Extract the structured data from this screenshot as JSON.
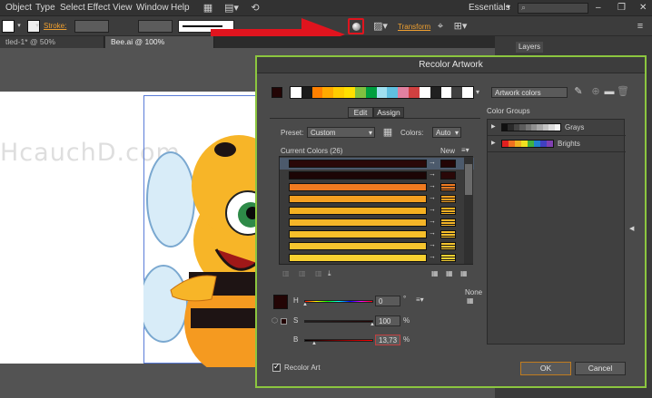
{
  "menu": {
    "items": [
      "Object",
      "Type",
      "Select",
      "Effect",
      "View",
      "Window",
      "Help"
    ],
    "workspace": "Essentials",
    "search_placeholder": ""
  },
  "control_bar": {
    "stroke_label": "Stroke:",
    "transform_label": "Transform"
  },
  "doc_tabs": [
    {
      "label": "tled-1* @ 50% (CMYK/Preview)",
      "active": false
    },
    {
      "label": "Bee.ai @ 100% (CMYK/Preview)",
      "active": true
    }
  ],
  "watermark": "HcauchD.com",
  "panels": {
    "layers_tab": "Layers"
  },
  "dialog": {
    "title": "Recolor Artwork",
    "artwork_colors_label": "Artwork colors",
    "tab_edit": "Edit",
    "tab_assign": "Assign",
    "preset_label": "Preset:",
    "preset_value": "Custom",
    "colors_label": "Colors:",
    "colors_value": "Auto",
    "current_colors_label": "Current Colors (26)",
    "new_label": "New",
    "none_label": "None",
    "h_label": "H",
    "s_label": "S",
    "b_label": "B",
    "h_value": "0",
    "s_value": "100",
    "b_value": "13,73",
    "h_unit": "°",
    "s_unit": "%",
    "b_unit": "%",
    "recolor_art_label": "Recolor Art",
    "recolor_art_checked": true,
    "ok_label": "OK",
    "cancel_label": "Cancel",
    "color_groups_label": "Color Groups",
    "groups": [
      {
        "name": "Grays",
        "colors": [
          "#101010",
          "#2a2a2a",
          "#444444",
          "#5c5c5c",
          "#767676",
          "#8f8f8f",
          "#a8a8a8",
          "#c2c2c2",
          "#dcdcdc",
          "#f5f5f5"
        ]
      },
      {
        "name": "Brights",
        "colors": [
          "#e02020",
          "#f07020",
          "#f0b020",
          "#f0e020",
          "#40b040",
          "#2080d0",
          "#4040c0",
          "#8040b0"
        ]
      }
    ],
    "harmony_strip": [
      "#ffffff",
      "#1a1a1a",
      "#ff8000",
      "#ffaa00",
      "#ffcc00",
      "#ffe000",
      "#80c040",
      "#00a040",
      "#a0e0f0",
      "#60c0e0",
      "#e080a0",
      "#d04040",
      "#ffffff",
      "#202020",
      "#ffffff",
      "#404040",
      "#ffffff"
    ],
    "current_colors": [
      {
        "current": "#2a0808",
        "new": "#230505"
      },
      {
        "current": "#1c0505",
        "new": "#2a0808"
      },
      {
        "current": "#f07a20",
        "new": "#f07a20"
      },
      {
        "current": "#f5a020",
        "new": "#f5a020"
      },
      {
        "current": "#f5b020",
        "new": "#f5b020"
      },
      {
        "current": "#f5b528",
        "new": "#f5b528"
      },
      {
        "current": "#f7bf2a",
        "new": "#f7bf2a"
      },
      {
        "current": "#f7c52e",
        "new": "#f7c52e"
      },
      {
        "current": "#f8d030",
        "new": "#f8d030"
      }
    ],
    "swatch_color": "#230505"
  },
  "colors": {
    "accent_green": "#8cc63f",
    "highlight_red": "#e0141e"
  }
}
